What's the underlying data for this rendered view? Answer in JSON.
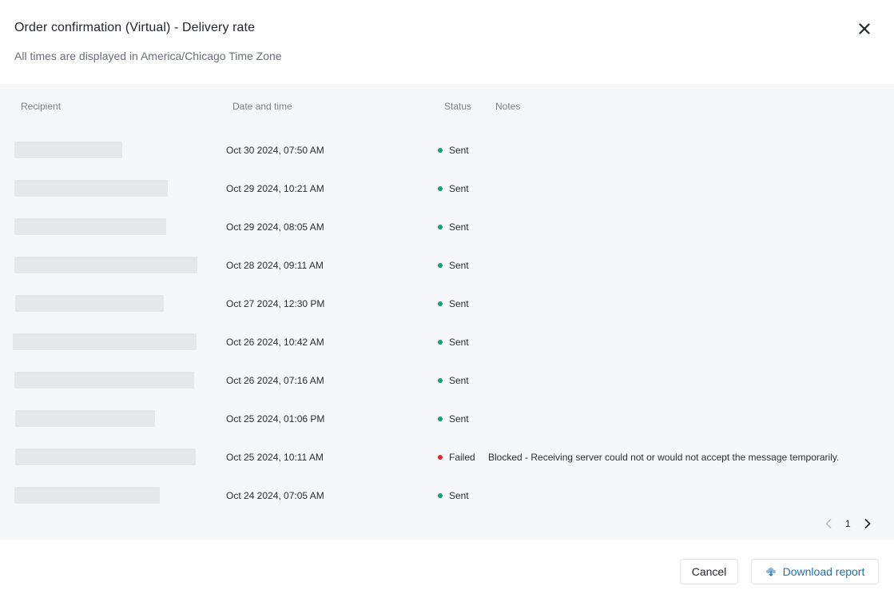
{
  "header": {
    "title": "Order confirmation (Virtual) - Delivery rate",
    "subtitle": "All times are displayed in America/Chicago Time Zone"
  },
  "table": {
    "columns": {
      "recipient": "Recipient",
      "date": "Date and time",
      "status": "Status",
      "notes": "Notes"
    },
    "rows": [
      {
        "date": "Oct 30 2024, 07:50 AM",
        "status": "Sent",
        "notes": ""
      },
      {
        "date": "Oct 29 2024, 10:21 AM",
        "status": "Sent",
        "notes": ""
      },
      {
        "date": "Oct 29 2024, 08:05 AM",
        "status": "Sent",
        "notes": ""
      },
      {
        "date": "Oct 28 2024, 09:11 AM",
        "status": "Sent",
        "notes": ""
      },
      {
        "date": "Oct 27 2024, 12:30 PM",
        "status": "Sent",
        "notes": ""
      },
      {
        "date": "Oct 26 2024, 10:42 AM",
        "status": "Sent",
        "notes": ""
      },
      {
        "date": "Oct 26 2024, 07:16 AM",
        "status": "Sent",
        "notes": ""
      },
      {
        "date": "Oct 25 2024, 01:06 PM",
        "status": "Sent",
        "notes": ""
      },
      {
        "date": "Oct 25 2024, 10:11 AM",
        "status": "Failed",
        "notes": "Blocked - Receiving server could not or would not accept the message temporarily."
      },
      {
        "date": "Oct 24 2024, 07:05 AM",
        "status": "Sent",
        "notes": ""
      }
    ]
  },
  "status_colors": {
    "Sent": "#12a36b",
    "Failed": "#e5262b"
  },
  "pagination": {
    "current_page": "1"
  },
  "footer": {
    "cancel_label": "Cancel",
    "download_label": "Download report",
    "download_icon": "cloud-download-icon"
  },
  "colors": {
    "accent": "#1f6fb2",
    "panel_bg": "#f6f7f8"
  }
}
